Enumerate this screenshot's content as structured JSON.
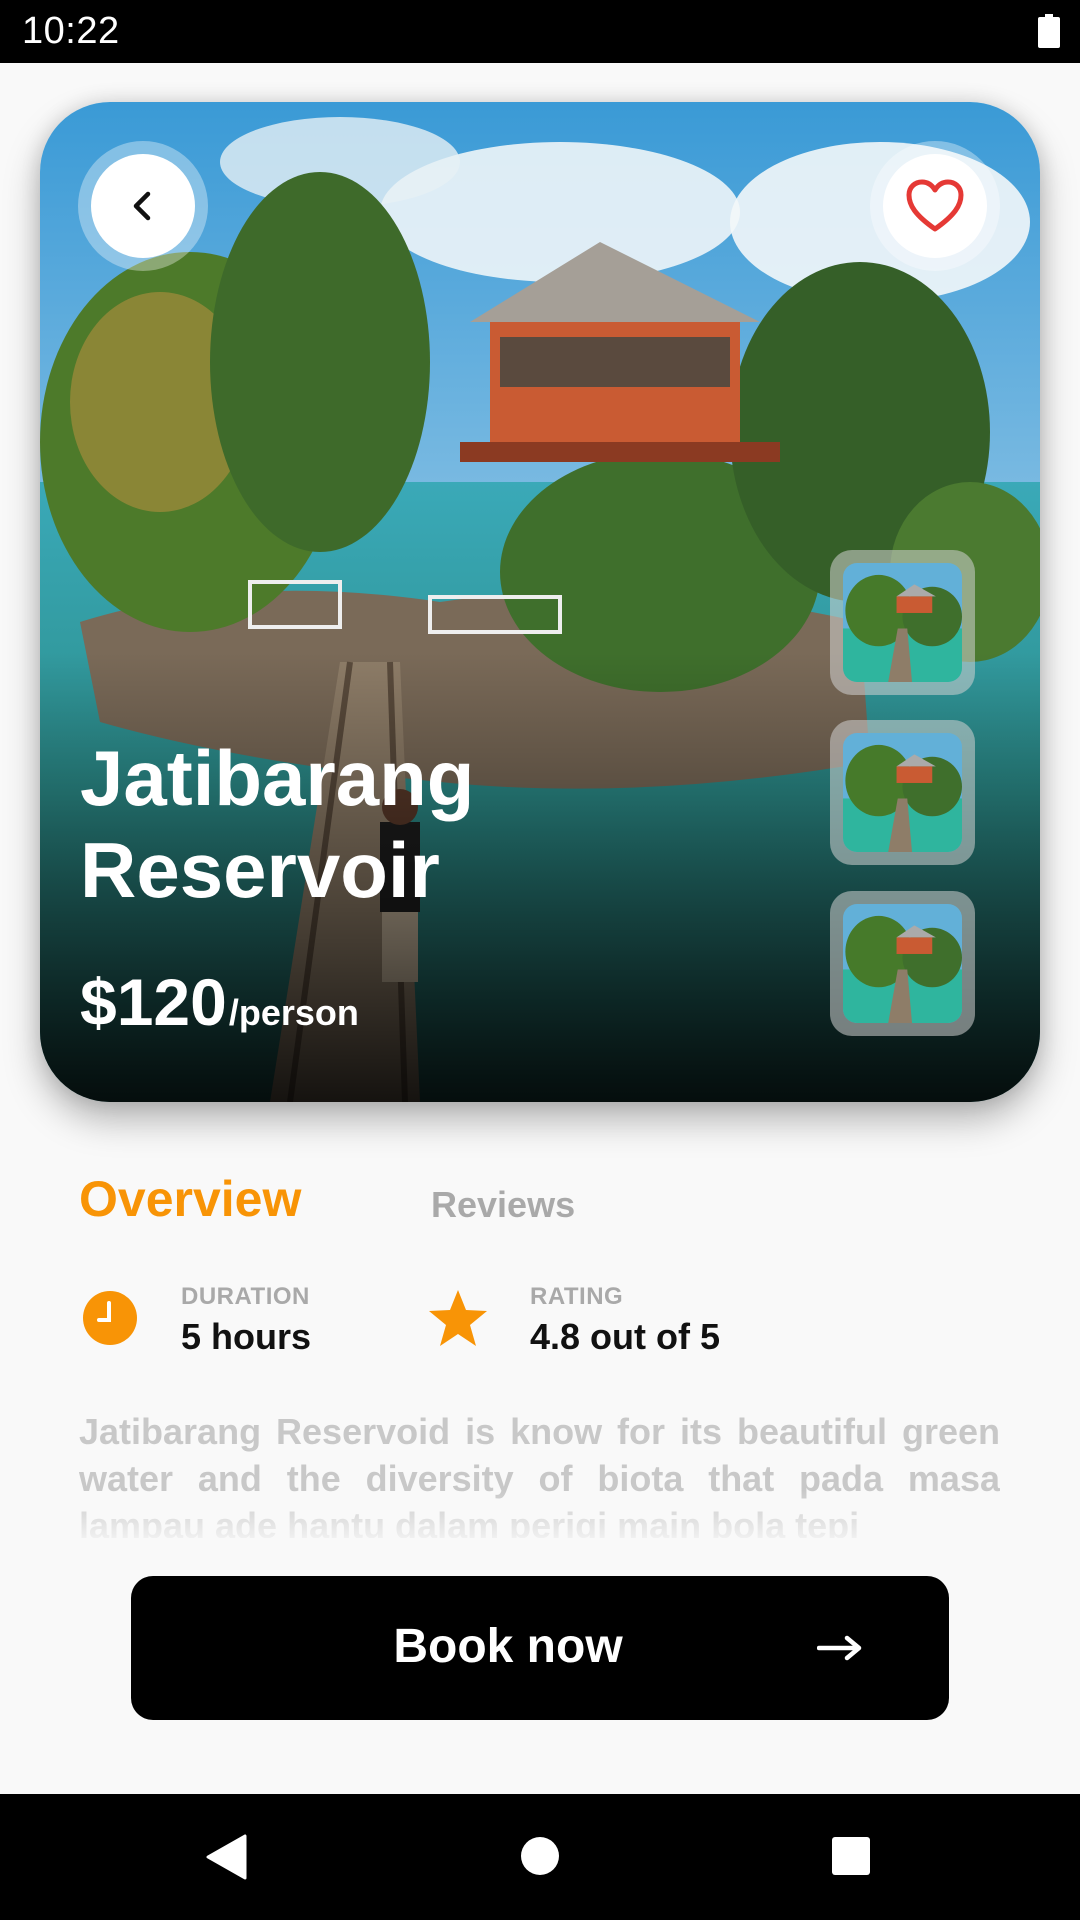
{
  "status_bar": {
    "time": "10:22"
  },
  "hero": {
    "title": "Jatibarang\nReservoir",
    "price": "$120",
    "price_unit": "/person",
    "thumbnails_count": 3
  },
  "tabs": [
    {
      "label": "Overview",
      "active": true
    },
    {
      "label": "Reviews",
      "active": false
    }
  ],
  "info": {
    "duration": {
      "label": "DURATION",
      "value": "5 hours",
      "icon": "clock-icon"
    },
    "rating": {
      "label": "RATING",
      "value": "4.8 out of 5",
      "icon": "star-icon"
    }
  },
  "description": "Jatibarang Reservoid is know for its beautiful green water and the diversity of biota that pada masa lampau ade hantu dalam perigi main bola tepi",
  "book_button": {
    "label": "Book now",
    "icon": "arrow-right-icon"
  },
  "colors": {
    "accent": "#f89406",
    "muted": "#a9a9a9",
    "button": "#000000"
  }
}
